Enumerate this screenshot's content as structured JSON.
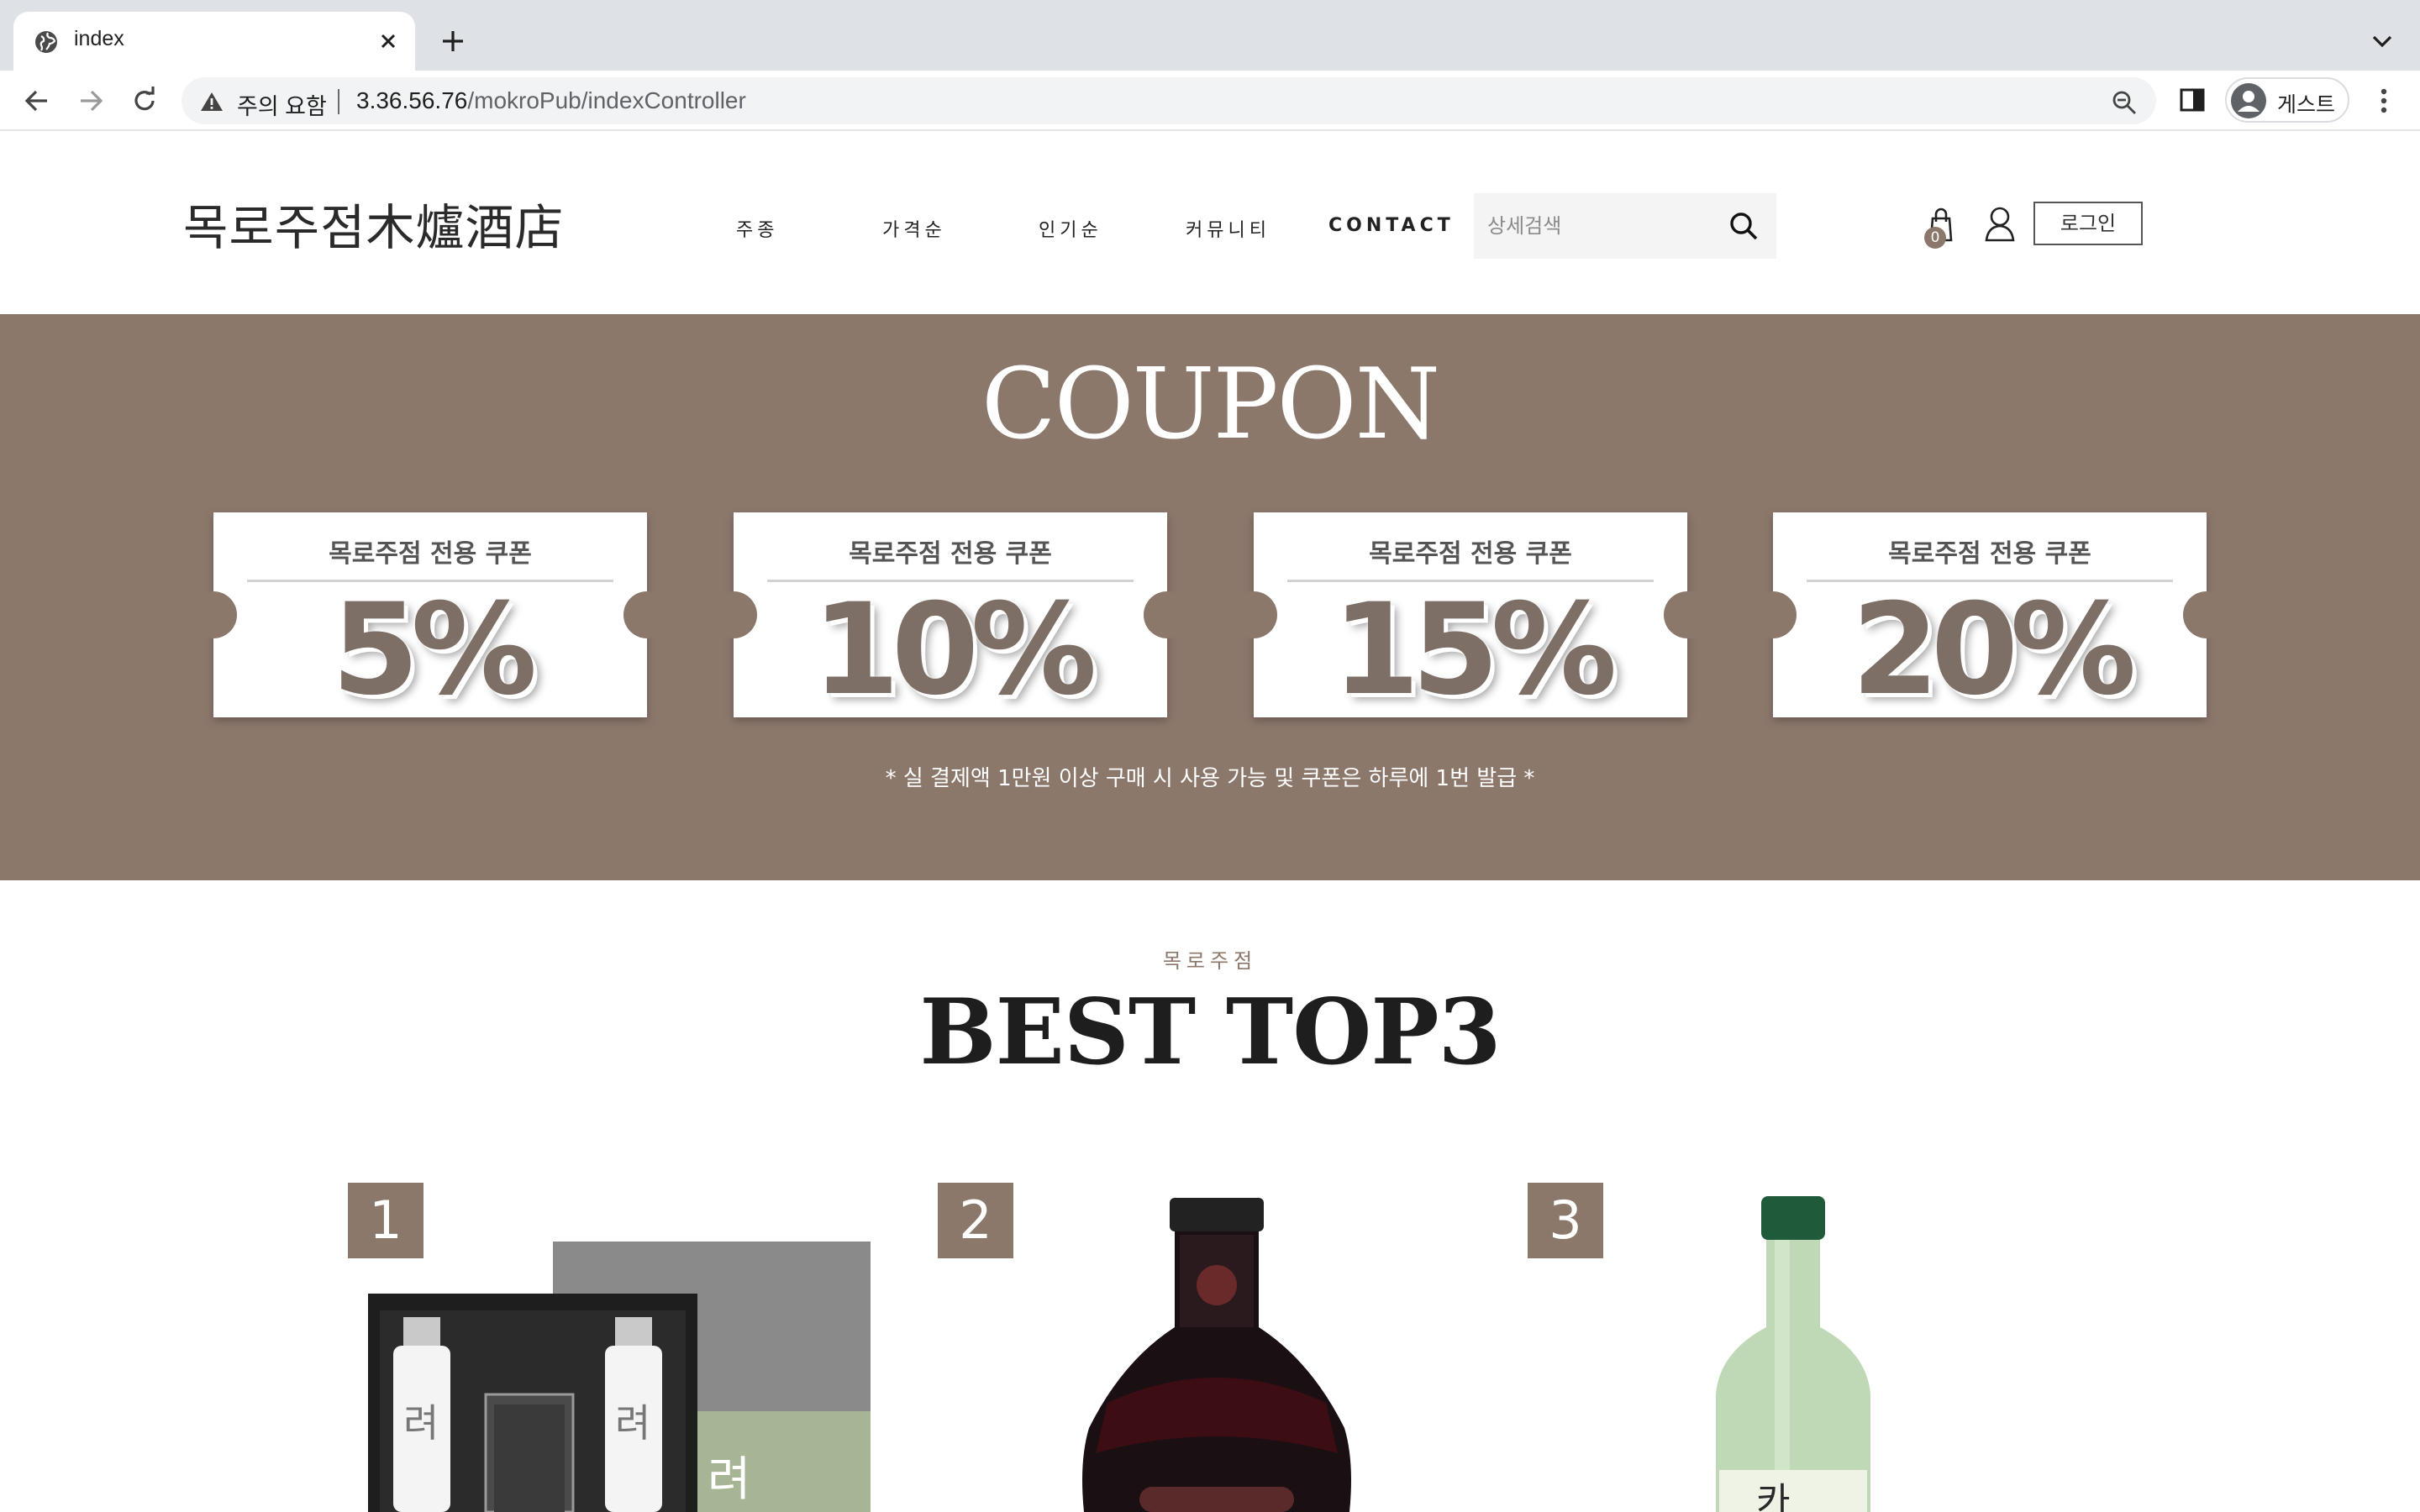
{
  "browser": {
    "tab_title": "index",
    "security_label": "주의 요함",
    "url_host": "3.36.56.76",
    "url_path": "/mokroPub/indexController",
    "profile_name": "게스트"
  },
  "header": {
    "logo": "목로주점木爐酒店",
    "nav": [
      "주종",
      "가격순",
      "인기순",
      "커뮤니티",
      "CONTACT"
    ],
    "search_placeholder": "상세검색",
    "cart_count": "0",
    "login_label": "로그인"
  },
  "coupon": {
    "title": "COUPON",
    "cards": [
      {
        "label": "목로주점 전용 쿠폰",
        "percent": "5%"
      },
      {
        "label": "목로주점 전용 쿠폰",
        "percent": "10%"
      },
      {
        "label": "목로주점 전용 쿠폰",
        "percent": "15%"
      },
      {
        "label": "목로주점 전용 쿠폰",
        "percent": "20%"
      }
    ],
    "note": "* 실 결제액 1만원 이상 구매 시 사용 가능 및 쿠폰은 하루에 1번 발급 *"
  },
  "best": {
    "kicker": "목로주점",
    "title": "BEST TOP3",
    "ranks": [
      "1",
      "2",
      "3"
    ]
  },
  "colors": {
    "accent": "#8c776b",
    "chrome": "#dee1e6"
  },
  "icons": [
    "globe-icon",
    "close-icon",
    "plus-icon",
    "chevron-down-icon",
    "back-arrow-icon",
    "forward-arrow-icon",
    "reload-icon",
    "warning-icon",
    "zoom-icon",
    "side-panel-icon",
    "avatar-icon",
    "kebab-menu-icon",
    "search-icon",
    "shopping-bag-icon",
    "user-icon"
  ]
}
